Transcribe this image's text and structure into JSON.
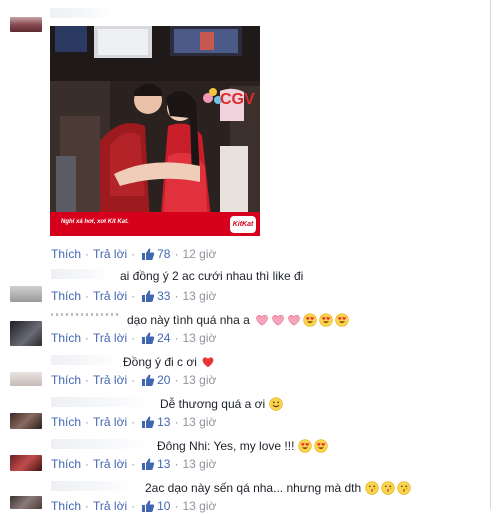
{
  "labels": {
    "like": "Thích",
    "reply": "Trả lời",
    "dot": "·"
  },
  "ad": {
    "caption": "Nghỉ xả hơi, xơi Kit Kat.",
    "brand": "KitKat",
    "cinema": "CGV"
  },
  "comments": [
    {
      "text": "",
      "likes": "78",
      "time": "12 giờ"
    },
    {
      "text": "ai đồng ý 2 ac cưới nhau thì like đi",
      "likes": "33",
      "time": "13 giờ"
    },
    {
      "text": "dạo này tình quá nha a",
      "likes": "24",
      "time": "13 giờ"
    },
    {
      "text": "Đồng ý đi c ơi",
      "likes": "20",
      "time": "13 giờ"
    },
    {
      "text": "Dễ thương quá a ơi",
      "likes": "13",
      "time": "13 giờ"
    },
    {
      "text": "Đông Nhi: Yes, my love !!!",
      "likes": "13",
      "time": "13 giờ"
    },
    {
      "text": "2ac dạo này sến qá nha... nhưng mà dth",
      "likes": "10",
      "time": "13 giờ"
    }
  ],
  "colors": {
    "link": "#4267b2",
    "meta": "#90949c",
    "text": "#1d2129",
    "kitkat": "#d6001c"
  },
  "icons": {
    "like": "thumbs-up-icon",
    "heart_eyes": "heart-eyes-emoji-icon",
    "heart": "heart-emoji-icon",
    "smile": "smile-emoji-icon",
    "kiss": "kiss-emoji-icon",
    "pink_heart": "pink-heart-emoji-icon"
  }
}
